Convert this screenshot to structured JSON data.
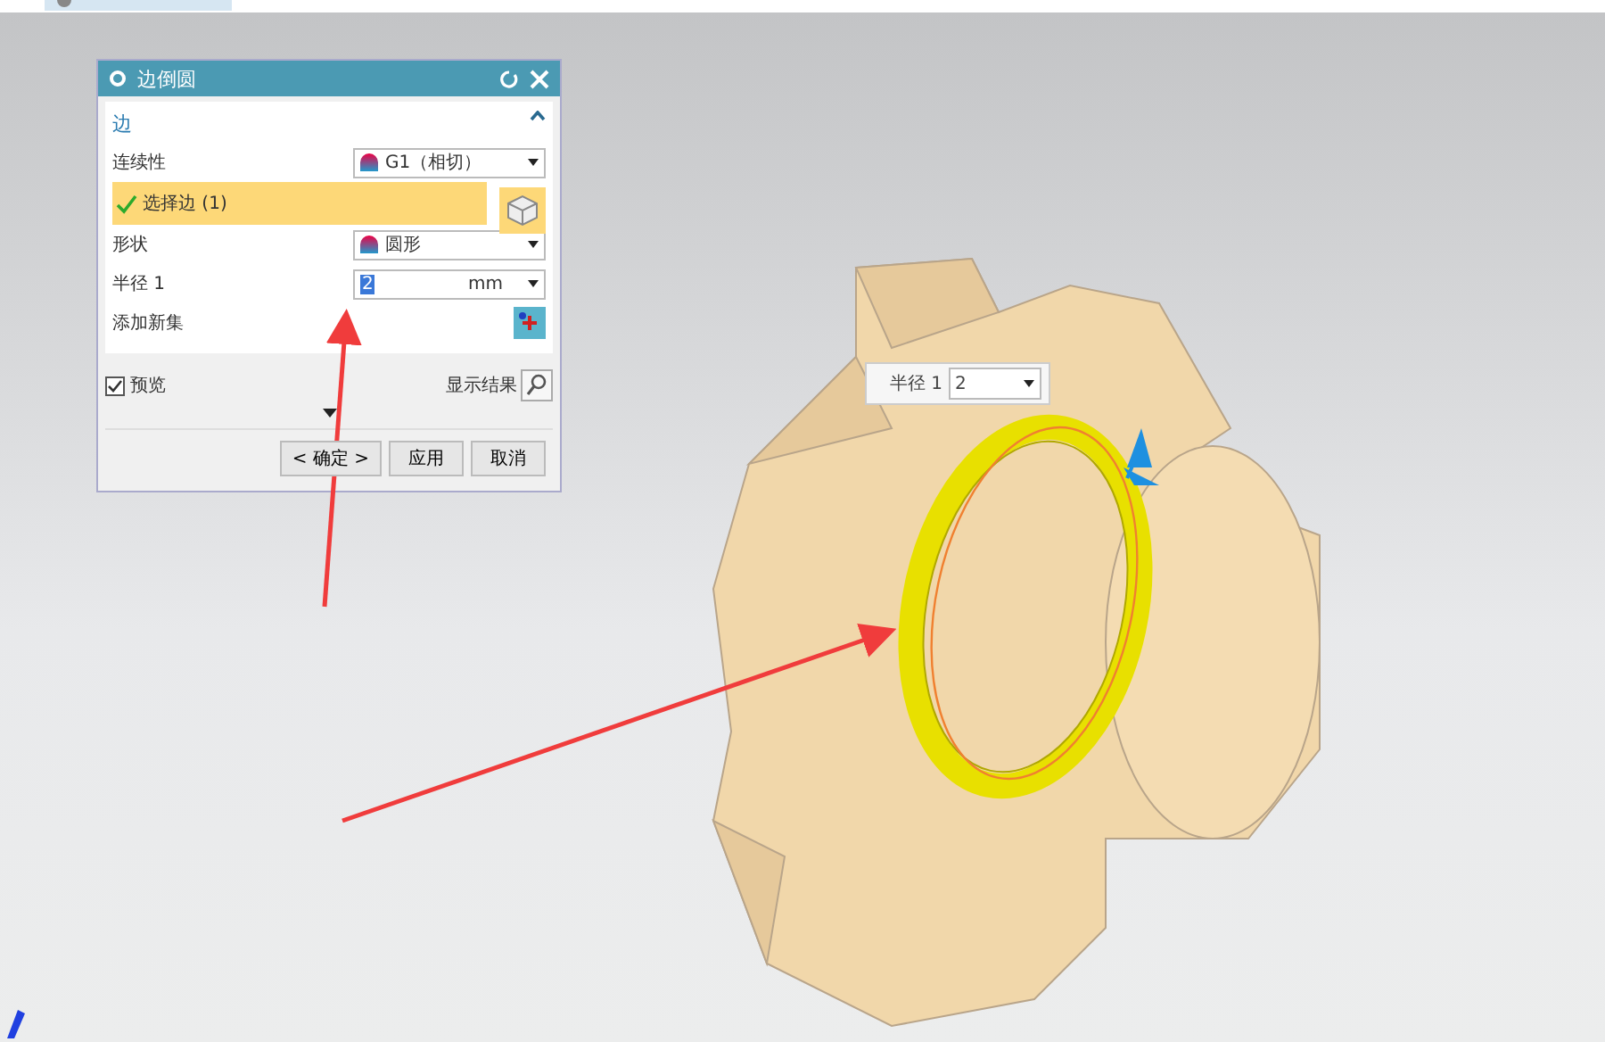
{
  "dialog": {
    "title": "边倒圆",
    "section": {
      "label": "边",
      "expanded": true
    },
    "continuity": {
      "label": "连续性",
      "value": "G1（相切）"
    },
    "select_edge": {
      "label": "选择边 (1)",
      "selected": true
    },
    "shape": {
      "label": "形状",
      "value": "圆形"
    },
    "radius": {
      "label": "半径 1",
      "value": "2",
      "unit": "mm"
    },
    "add_set": {
      "label": "添加新集"
    },
    "preview": {
      "label": "预览",
      "checked": true
    },
    "show_result": {
      "label": "显示结果"
    },
    "buttons": [
      "< 确定 >",
      "应用",
      "取消"
    ]
  },
  "floating_field": {
    "label": "半径 1",
    "value": "2"
  }
}
